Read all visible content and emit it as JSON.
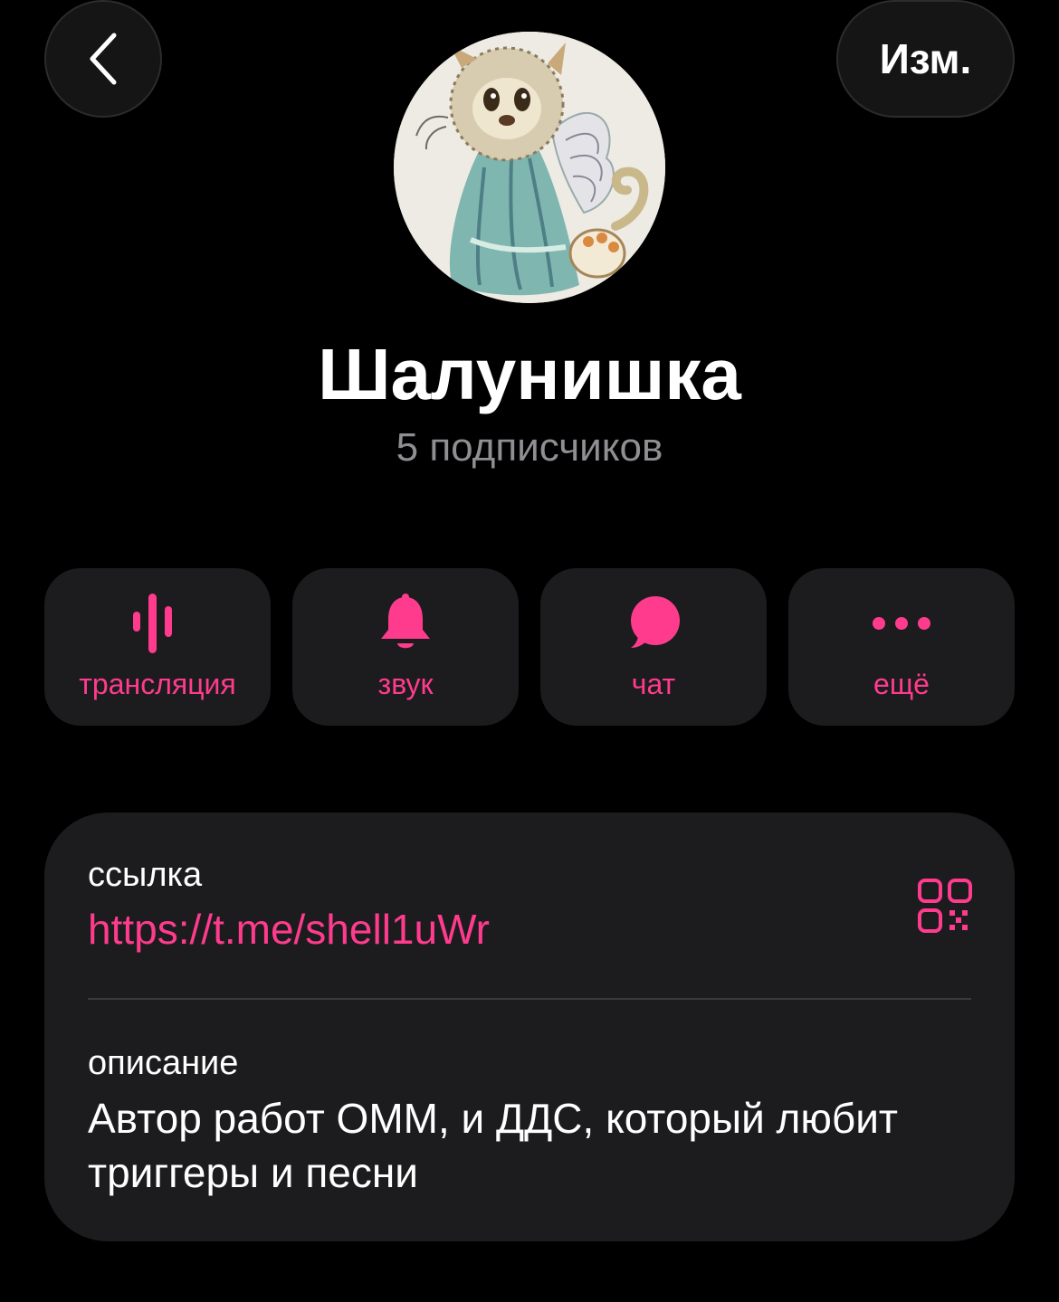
{
  "header": {
    "back_icon": "chevron-left-icon",
    "edit_label": "Изм."
  },
  "profile": {
    "avatar_alt": "avatar",
    "name": "Шалунишка",
    "subscribers": "5 подписчиков"
  },
  "actions": [
    {
      "icon": "live-stream-icon",
      "label": "трансляция"
    },
    {
      "icon": "bell-icon",
      "label": "звук"
    },
    {
      "icon": "chat-bubble-icon",
      "label": "чат"
    },
    {
      "icon": "more-dots-icon",
      "label": "ещё"
    }
  ],
  "info": {
    "link_label": "ссылка",
    "link_value": "https://t.me/shell1uWr",
    "qr_icon": "qr-code-icon",
    "description_label": "описание",
    "description_value": "Автор работ ОММ, и ДДС, который любит триггеры и песни"
  },
  "colors": {
    "accent": "#ff3b8e",
    "background": "#000000",
    "card": "#1c1c1e",
    "secondary_text": "#8e8e93"
  }
}
